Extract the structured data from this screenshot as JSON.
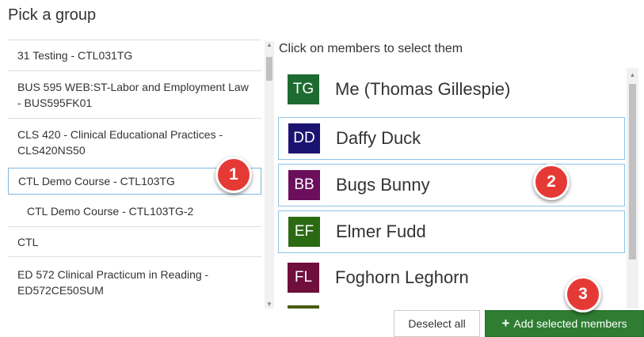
{
  "page": {
    "title": "Pick a group"
  },
  "groups": [
    {
      "label": "31 Testing - CTL031TG"
    },
    {
      "label": "BUS 595 WEB:ST-Labor and Employment Law - BUS595FK01"
    },
    {
      "label": "CLS 420 - Clinical Educational Practices - CLS420NS50"
    },
    {
      "label": "CTL Demo Course - CTL103TG",
      "active": true
    },
    {
      "label": "CTL Demo Course - CTL103TG-2"
    },
    {
      "label": "CTL"
    },
    {
      "label": "ED 572 Clinical Practicum in Reading - ED572CE50SUM"
    }
  ],
  "members_panel": {
    "instruction": "Click on members to select them"
  },
  "members": [
    {
      "initials": "TG",
      "name": "Me (Thomas Gillespie)",
      "color": "#1e6b32",
      "selected": false
    },
    {
      "initials": "DD",
      "name": "Daffy Duck",
      "color": "#1a1470",
      "selected": true
    },
    {
      "initials": "BB",
      "name": "Bugs Bunny",
      "color": "#6b0f5c",
      "selected": true
    },
    {
      "initials": "EF",
      "name": "Elmer Fudd",
      "color": "#2b6a12",
      "selected": true
    },
    {
      "initials": "FL",
      "name": "Foghorn Leghorn",
      "color": "#6e0f3c",
      "selected": false
    }
  ],
  "buttons": {
    "deselect_all": "Deselect all",
    "add_selected": "Add selected members",
    "add_icon": "+"
  },
  "callouts": [
    "1",
    "2",
    "3"
  ],
  "colors": {
    "accent_blue": "#8ec3e6",
    "add_button": "#2e7d32",
    "callout": "#e53935"
  }
}
